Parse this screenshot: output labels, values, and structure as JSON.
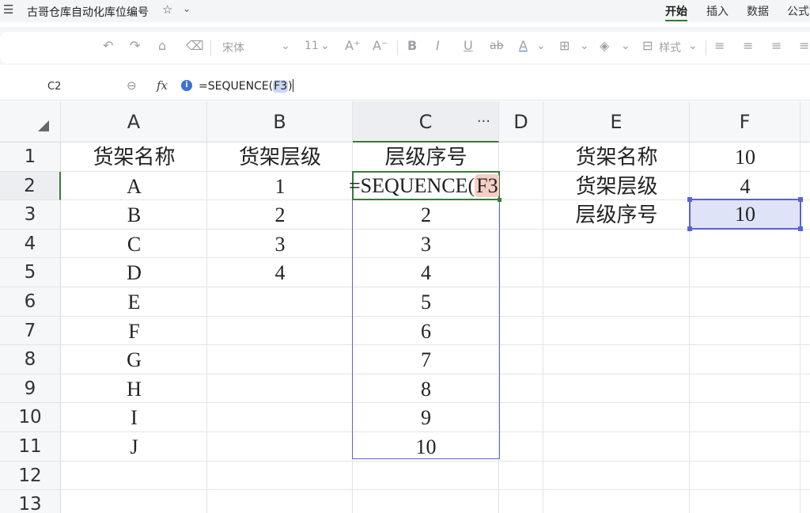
{
  "app": {
    "menu_icon": "hamburger-menu-icon",
    "doc_title": "古哥仓库自动化库位编号",
    "tabs": [
      "开始",
      "插入",
      "数据",
      "公式"
    ],
    "active_tab": "开始"
  },
  "toolbar": {
    "font_name": "宋体",
    "font_size": "11",
    "style_label": "样式"
  },
  "formula_bar": {
    "cell_ref": "C2",
    "formula_prefix": "=SEQUENCE(",
    "formula_ref": "F3",
    "formula_suffix": ")"
  },
  "sheet": {
    "columns": [
      "A",
      "B",
      "C",
      "D",
      "E",
      "F"
    ],
    "rows": [
      "1",
      "2",
      "3",
      "4",
      "5",
      "6",
      "7",
      "8",
      "9",
      "10",
      "11",
      "12",
      "13"
    ],
    "col_A": [
      "货架名称",
      "A",
      "B",
      "C",
      "D",
      "E",
      "F",
      "G",
      "H",
      "I",
      "J"
    ],
    "col_B": [
      "货架层级",
      "1",
      "2",
      "3",
      "4"
    ],
    "col_C": [
      "层级序号",
      "",
      "2",
      "3",
      "4",
      "5",
      "6",
      "7",
      "8",
      "9",
      "10"
    ],
    "col_E": [
      "货架名称",
      "货架层级",
      "层级序号"
    ],
    "col_F": [
      "10",
      "4",
      "10"
    ],
    "active_edit_prefix": "=SEQUENCE(",
    "active_edit_ref": "F3",
    "active_edit_suffix": ")"
  },
  "colors": {
    "active_green": "#3a7a3a",
    "range_blue": "#5b62d6",
    "ref_highlight": "#f5cfc6"
  }
}
